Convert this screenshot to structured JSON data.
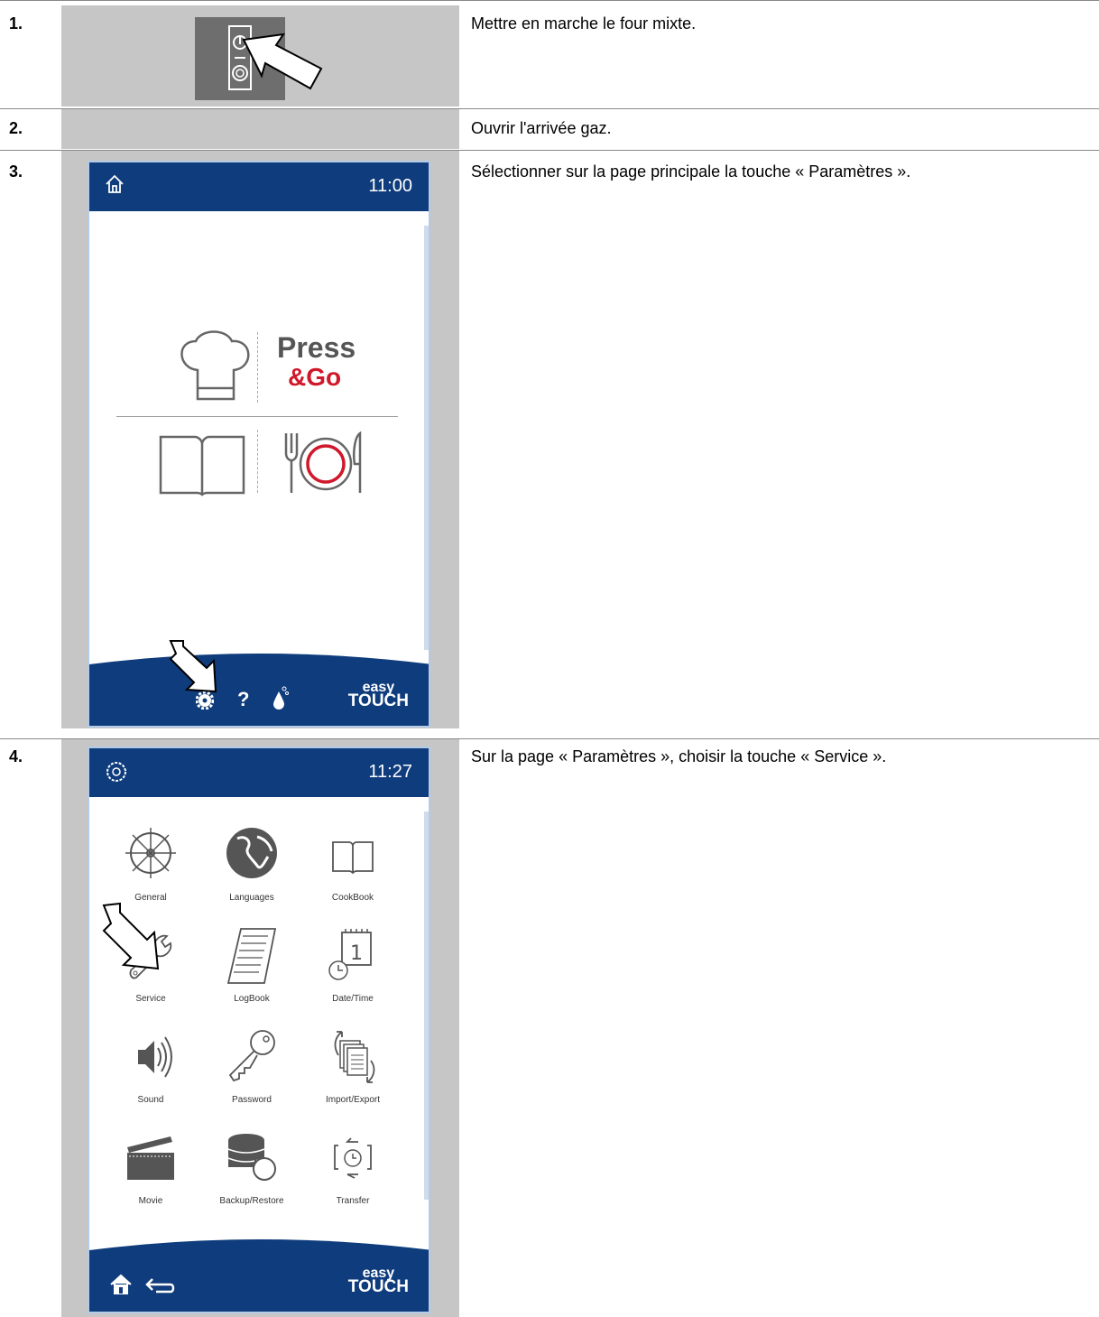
{
  "steps": [
    {
      "num": "1.",
      "text": "Mettre en marche le four mixte."
    },
    {
      "num": "2.",
      "text": "Ouvrir l'arrivée gaz."
    },
    {
      "num": "3.",
      "text": "Sélectionner sur la page principale la touche « Paramètres »."
    },
    {
      "num": "4.",
      "text": "Sur la page « Paramètres », choisir la touche « Service »."
    }
  ],
  "screen_home": {
    "time": "11:00",
    "press": "Press",
    "go": "&Go",
    "help": "?",
    "brand_top": "easy",
    "brand_bottom": "TOUCH"
  },
  "screen_settings": {
    "time": "11:27",
    "brand_top": "easy",
    "brand_bottom": "TOUCH",
    "tiles": [
      {
        "label": "General",
        "icon": "ship-wheel-icon"
      },
      {
        "label": "Languages",
        "icon": "globe-icon"
      },
      {
        "label": "CookBook",
        "icon": "book-icon"
      },
      {
        "label": "Service",
        "icon": "wrench-icon"
      },
      {
        "label": "LogBook",
        "icon": "document-icon"
      },
      {
        "label": "Date/Time",
        "icon": "calendar-icon"
      },
      {
        "label": "Sound",
        "icon": "speaker-icon"
      },
      {
        "label": "Password",
        "icon": "key-icon"
      },
      {
        "label": "Import/Export",
        "icon": "import-export-icon"
      },
      {
        "label": "Movie",
        "icon": "clapperboard-icon"
      },
      {
        "label": "Backup/Restore",
        "icon": "database-restore-icon"
      },
      {
        "label": "Transfer",
        "icon": "transfer-icon"
      }
    ]
  },
  "colors": {
    "bar": "#0f3c7c",
    "accent_red": "#d0182a",
    "cell_gray": "#c6c6c6"
  }
}
